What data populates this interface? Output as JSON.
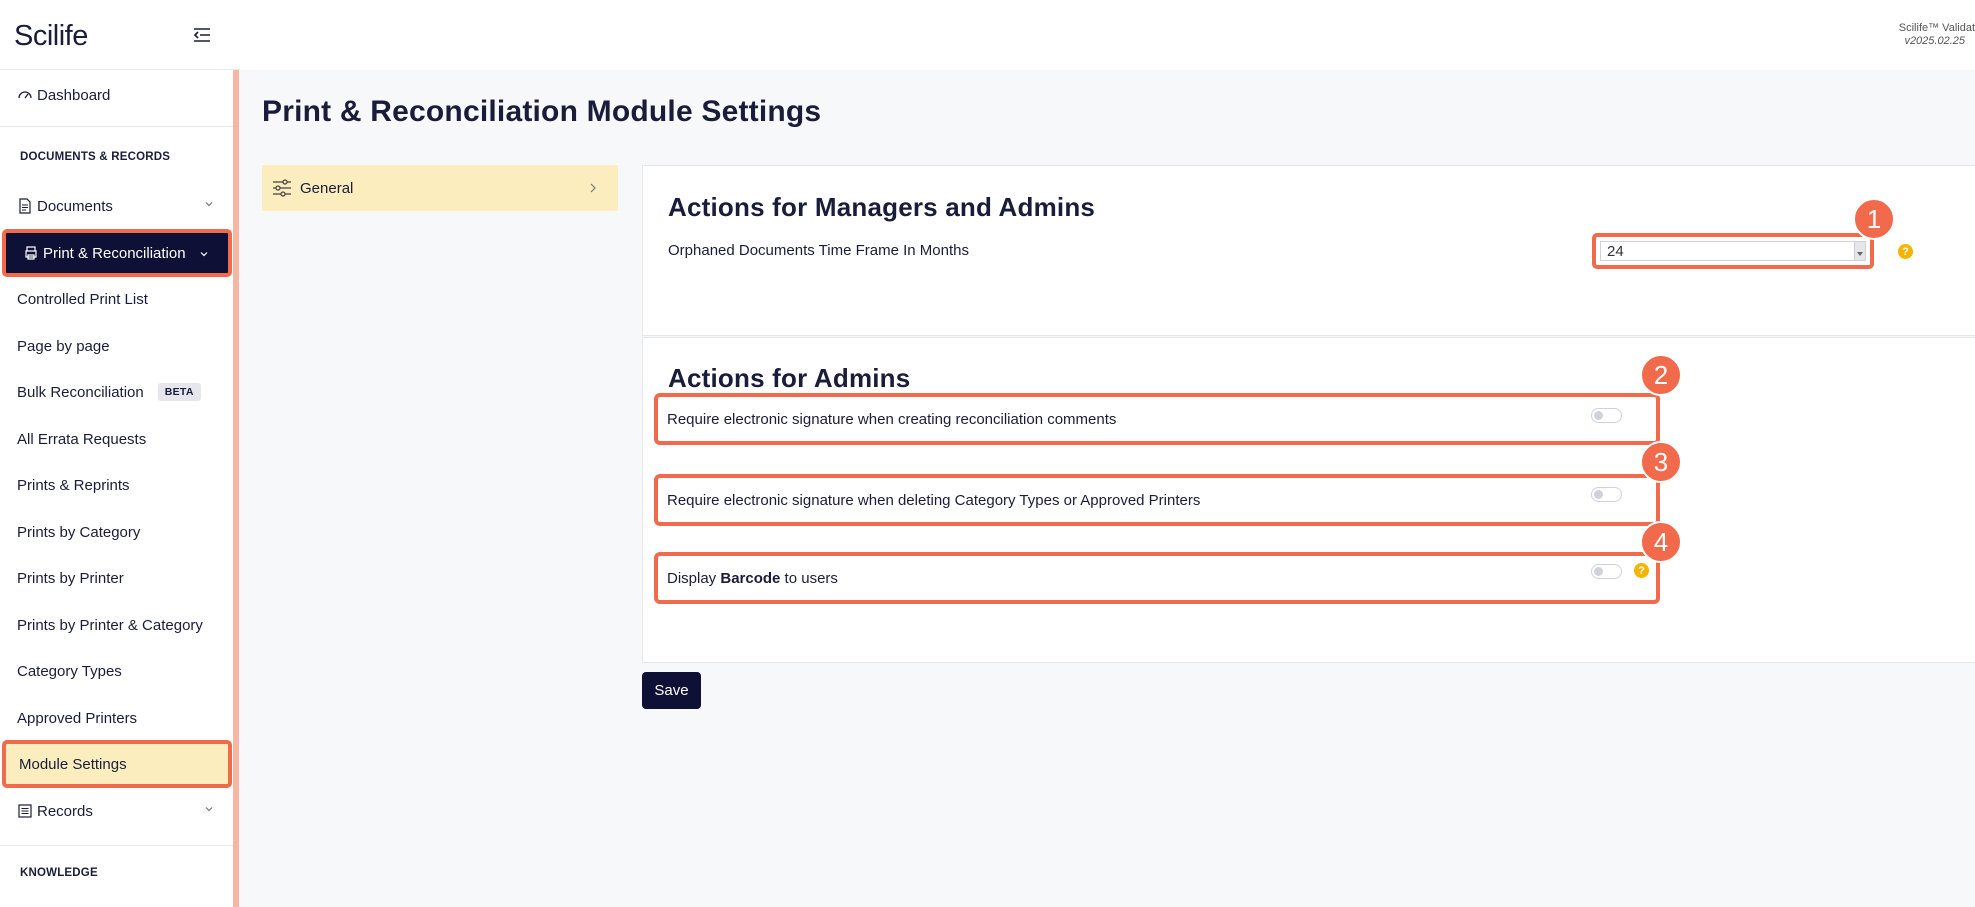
{
  "app": {
    "logo": "Scilife",
    "version_name": "Scilife™ Validat",
    "version_num": "v2025.02.25"
  },
  "sidebar": {
    "dashboard": "Dashboard",
    "section_docs": "DOCUMENTS & RECORDS",
    "documents": "Documents",
    "print_reconciliation": "Print & Reconciliation",
    "sub_items": [
      "Controlled Print List",
      "Page by page",
      "Bulk Reconciliation",
      "All Errata Requests",
      "Prints & Reprints",
      "Prints by Category",
      "Prints by Printer",
      "Prints by Printer & Category",
      "Category Types",
      "Approved Printers",
      "Module Settings"
    ],
    "beta": "BETA",
    "records": "Records",
    "section_knowledge": "KNOWLEDGE"
  },
  "main": {
    "title": "Print & Reconciliation Module Settings",
    "tab_general": "General",
    "managers_title": "Actions for Managers and Admins",
    "orphaned_label": "Orphaned Documents Time Frame In Months",
    "orphaned_value": "24",
    "admins_title": "Actions for Admins",
    "setting1": "Require electronic signature when creating reconciliation comments",
    "setting2": "Require electronic signature when deleting Category Types or Approved Printers",
    "setting3_pre": "Display ",
    "setting3_bold": "Barcode",
    "setting3_post": " to users",
    "save": "Save",
    "help": "?",
    "badges": [
      "1",
      "2",
      "3",
      "4"
    ]
  },
  "colors": {
    "accent": "#f06a4b",
    "navy": "#0e1035",
    "highlight": "#fbedbd",
    "help": "#f5b400"
  }
}
